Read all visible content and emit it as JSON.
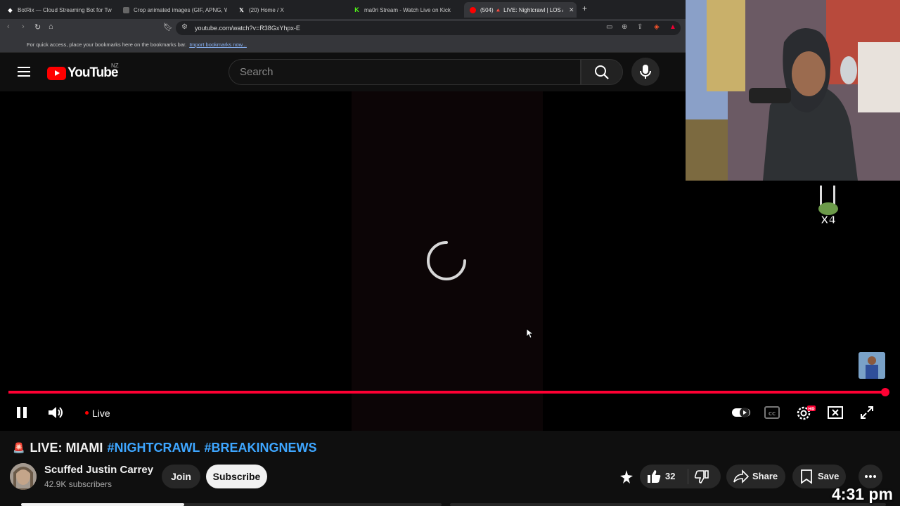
{
  "browser": {
    "tabs": [
      {
        "label": "BotRix — Cloud Streaming Bot for Tw",
        "icon": "botrix-icon"
      },
      {
        "label": "Crop animated images (GIF, APNG, W",
        "icon": "ezgif-icon"
      },
      {
        "label": "(20) Home / X",
        "icon": "x-icon"
      },
      {
        "label": "ma0ri Stream - Watch Live on Kick",
        "icon": "kick-icon"
      },
      {
        "label": "(504) 🔺 LIVE: Nightcrawl | LOS A",
        "icon": "youtube-icon",
        "active": true
      }
    ],
    "url": "youtube.com/watch?v=R38GxYhpx-E",
    "bookmarks_hint": "For quick access, place your bookmarks here on the bookmarks bar.",
    "bookmarks_link": "Import bookmarks now..."
  },
  "header": {
    "logo_text": "YouTube",
    "region": "NZ",
    "search_placeholder": "Search"
  },
  "player": {
    "live_label": "Live",
    "progress": 1.0,
    "state": "loading",
    "accent": "#ff0033"
  },
  "video": {
    "title_emoji": "🚨",
    "title_main": "LIVE: MIAMI",
    "hashtags": [
      "#NIGHTCRAWL",
      "#BREAKINGNEWS"
    ],
    "channel_name": "Scuffed Justin Carrey",
    "subscribers": "42.9K subscribers",
    "join_label": "Join",
    "subscribe_label": "Subscribe",
    "like_count": "32",
    "share_label": "Share",
    "save_label": "Save"
  },
  "overlay": {
    "badge_text": "X4",
    "clock": "4:31 pm"
  }
}
